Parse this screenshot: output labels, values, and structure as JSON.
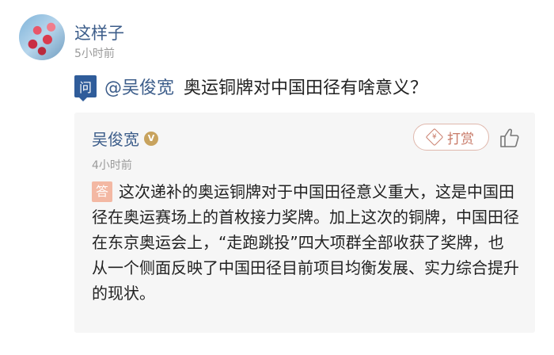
{
  "post": {
    "username": "这样子",
    "time": "5小时前"
  },
  "question": {
    "badge": "问",
    "mention": "@吴俊宽",
    "text": "奥运铜牌对中国田径有啥意义？"
  },
  "answer": {
    "name": "吴俊宽",
    "verified_badge": "V",
    "tip_label": "打赏",
    "time": "4小时前",
    "badge": "答",
    "text": "这次递补的奥运铜牌对于中国田径意义重大，这是中国田径在奥运赛场上的首枚接力奖牌。加上这次的铜牌，中国田径在东京奥运会上，“走跑跳投”四大项群全部收获了奖牌，也从一个侧面反映了中国田径目前项目均衡发展、实力综合提升的现状。"
  },
  "colors": {
    "link": "#3c5d8a",
    "question_badge": "#2f5c9a",
    "answer_badge": "#f3b8a3",
    "tip": "#c87a68",
    "card_bg": "#f6f6f6"
  },
  "icons": {
    "tip": "diamond-tip-icon",
    "like": "thumbs-up-icon"
  }
}
